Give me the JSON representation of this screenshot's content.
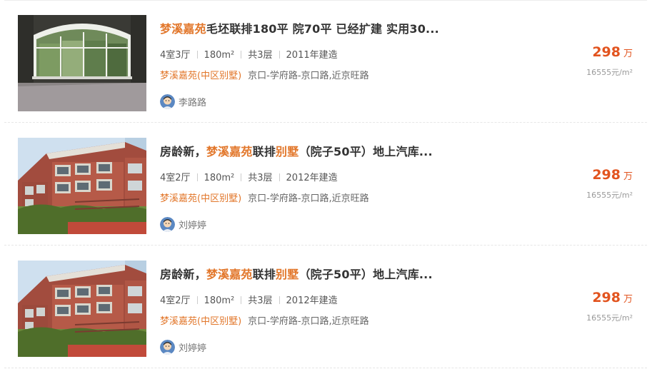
{
  "listings": [
    {
      "title_parts": [
        {
          "text": "梦溪嘉苑",
          "hl": true
        },
        {
          "text": "毛坯联排180平 院70平 已经扩建 实用30...",
          "hl": false
        }
      ],
      "attrs": [
        "4室3厅",
        "180m²",
        "共3层",
        "2011年建造"
      ],
      "community": "梦溪嘉苑(中区别墅)",
      "address": "京口-学府路-京口路,近京旺路",
      "agent": "李路路",
      "price": "298",
      "price_unit": "万",
      "unit_price": "16555元/m²",
      "photo": "interior-icon"
    },
    {
      "title_parts": [
        {
          "text": "房龄新，",
          "hl": false
        },
        {
          "text": "梦溪嘉苑",
          "hl": true
        },
        {
          "text": "联排",
          "hl": false
        },
        {
          "text": "别墅",
          "hl": true
        },
        {
          "text": "（院子50平）地上汽库...",
          "hl": false
        }
      ],
      "attrs": [
        "4室2厅",
        "180m²",
        "共3层",
        "2012年建造"
      ],
      "community": "梦溪嘉苑(中区别墅)",
      "address": "京口-学府路-京口路,近京旺路",
      "agent": "刘婷婷",
      "price": "298",
      "price_unit": "万",
      "unit_price": "16555元/m²",
      "photo": "townhouse-icon"
    },
    {
      "title_parts": [
        {
          "text": "房龄新，",
          "hl": false
        },
        {
          "text": "梦溪嘉苑",
          "hl": true
        },
        {
          "text": "联排",
          "hl": false
        },
        {
          "text": "别墅",
          "hl": true
        },
        {
          "text": "（院子50平）地上汽库...",
          "hl": false
        }
      ],
      "attrs": [
        "4室2厅",
        "180m²",
        "共3层",
        "2012年建造"
      ],
      "community": "梦溪嘉苑(中区别墅)",
      "address": "京口-学府路-京口路,近京旺路",
      "agent": "刘婷婷",
      "price": "298",
      "price_unit": "万",
      "unit_price": "16555元/m²",
      "photo": "townhouse-icon"
    }
  ],
  "colors": {
    "highlight": "#e2772b",
    "price": "#e2541f",
    "meta": "#999999"
  }
}
